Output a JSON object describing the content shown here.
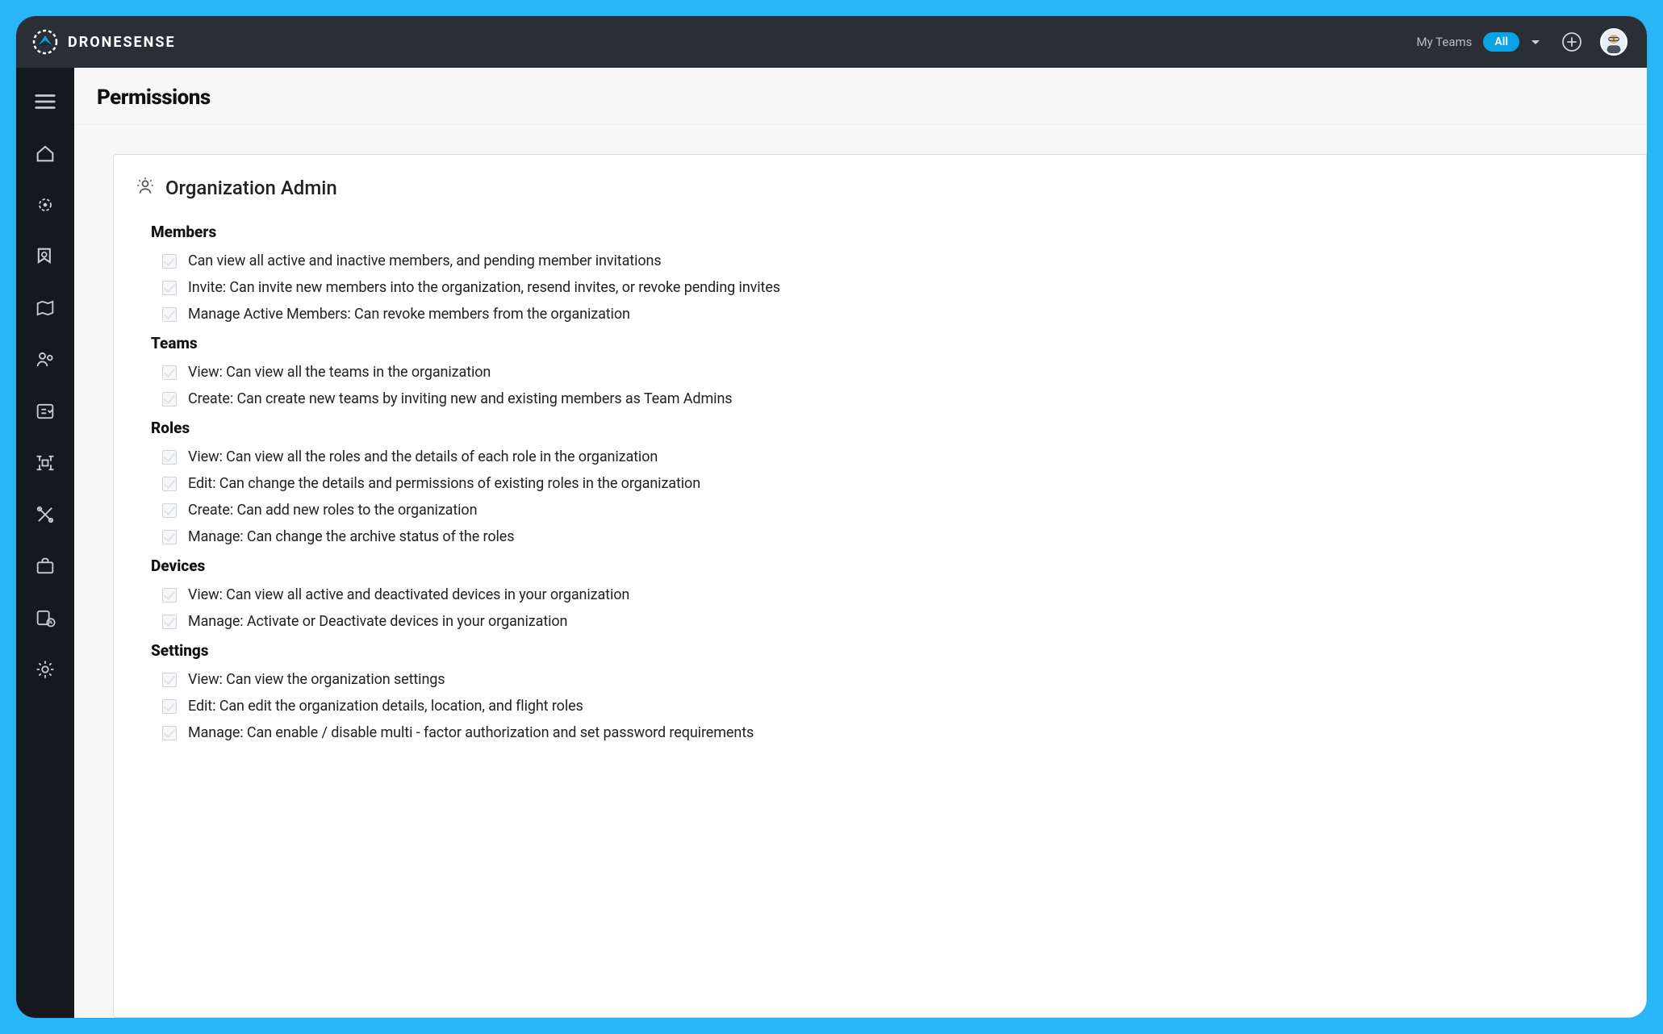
{
  "brand": {
    "name": "DRONESENSE"
  },
  "header": {
    "teams_label": "My Teams",
    "filter_pill": "All"
  },
  "page": {
    "title": "Permissions"
  },
  "role_card": {
    "title": "Organization Admin",
    "groups": [
      {
        "title": "Members",
        "items": [
          "Can view all active and inactive members, and pending member invitations",
          "Invite: Can invite new members into the organization, resend invites, or revoke pending invites",
          "Manage Active Members: Can revoke members from the organization"
        ]
      },
      {
        "title": "Teams",
        "items": [
          "View: Can view all the teams in the organization",
          "Create: Can create new teams by inviting new and existing members as Team Admins"
        ]
      },
      {
        "title": "Roles",
        "items": [
          "View: Can view all the roles and the details of each role in the organization",
          "Edit: Can change the details and permissions of existing roles in the organization",
          "Create: Can add new roles to the organization",
          "Manage: Can change the archive status of the roles"
        ]
      },
      {
        "title": "Devices",
        "items": [
          "View: Can view all active and deactivated devices in your organization",
          "Manage: Activate or Deactivate devices in your organization"
        ]
      },
      {
        "title": "Settings",
        "items": [
          "View: Can view the organization settings",
          "Edit: Can edit the organization details, location, and flight roles",
          "Manage: Can enable / disable multi - factor authorization and set password requirements"
        ]
      }
    ]
  }
}
